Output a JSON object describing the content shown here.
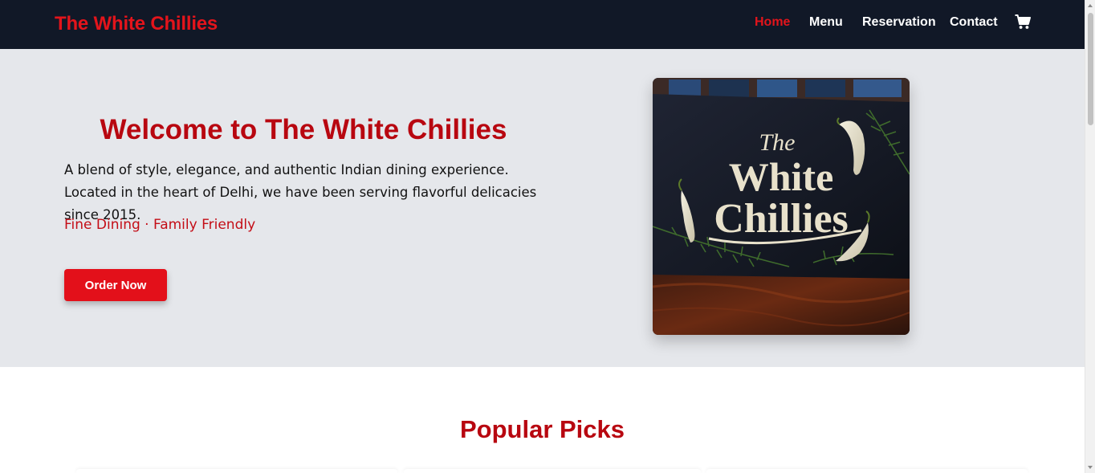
{
  "navbar": {
    "brand": "The White Chillies",
    "links": [
      {
        "label": "Home",
        "active": true
      },
      {
        "label": "Menu",
        "active": false
      },
      {
        "label": "Reservation",
        "active": false
      },
      {
        "label": "Contact",
        "active": false
      }
    ],
    "cart_icon": "shopping-cart-icon"
  },
  "hero": {
    "title": "Welcome to The White Chillies",
    "description": "A blend of style, elegance, and authentic Indian dining experience. Located in the heart of Delhi, we have been serving flavorful delicacies since 2015.",
    "tags": "Fine Dining · Family Friendly",
    "button_label": "Order Now",
    "image_sign": {
      "line1": "The",
      "line2": "White",
      "line3": "Chillies"
    }
  },
  "popular": {
    "title": "Popular Picks"
  },
  "colors": {
    "accent": "#e3141b",
    "title_red": "#b80710",
    "navbar_bg": "#111827",
    "hero_bg": "#e5e7eb"
  }
}
